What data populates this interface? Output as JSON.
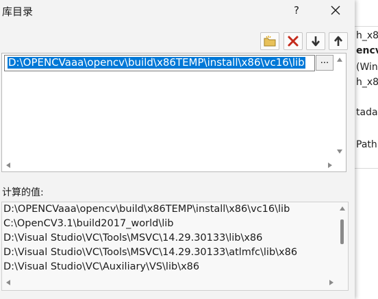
{
  "dialog": {
    "title": "库目录",
    "help_label": "?",
    "computed_label": "计算的值:"
  },
  "toolbar": {
    "new_line_icon": "folder-new-icon",
    "delete_icon": "delete-icon",
    "move_down_icon": "move-down-icon",
    "move_up_icon": "move-up-icon"
  },
  "list": {
    "entry_value": "D:\\OPENCVaaa\\opencv\\build\\x86TEMP\\install\\x86\\vc16\\lib",
    "browse_label": "..."
  },
  "computed": {
    "lines": [
      "D:\\OPENCVaaa\\opencv\\build\\x86TEMP\\install\\x86\\vc16\\lib",
      "C:\\OpenCV3.1\\build2017_world\\lib",
      "D:\\Visual Studio\\VC\\Tools\\MSVC\\14.29.30133\\lib\\x86",
      "D:\\Visual Studio\\VC\\Tools\\MSVC\\14.29.30133\\atlmfc\\lib\\x86",
      "D:\\Visual Studio\\VC\\Auxiliary\\VS\\lib\\x86"
    ]
  },
  "background": {
    "fragments": [
      "h_x8",
      "encv",
      "(Win",
      "h_x8",
      "tada",
      "Path);"
    ]
  },
  "colors": {
    "selection": "#0078d7",
    "delete": "#c42b1c"
  }
}
